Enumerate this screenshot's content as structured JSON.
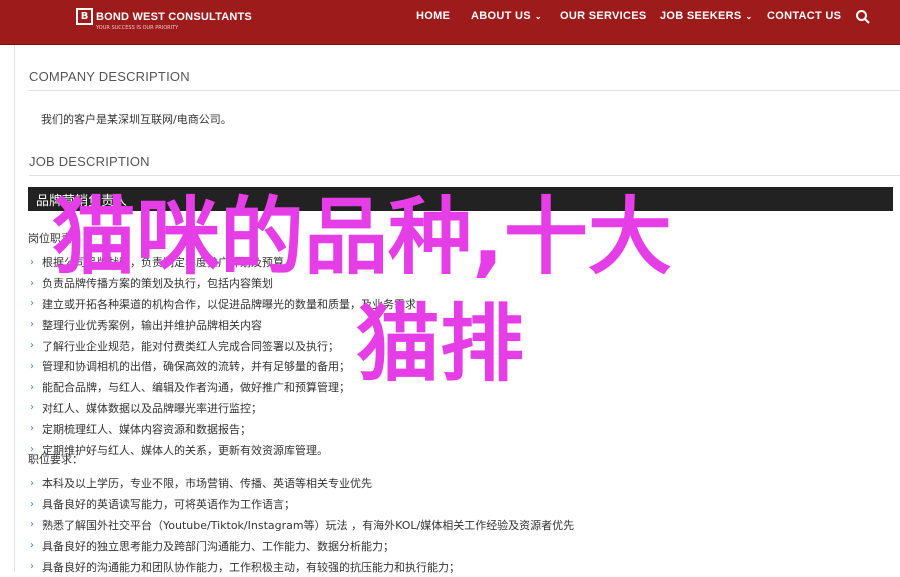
{
  "brand": {
    "name": "BOND WEST CONSULTANTS",
    "mark": "B",
    "tagline": "YOUR SUCCESS IS OUR PRIORITY"
  },
  "nav": [
    {
      "label": "HOME",
      "caret": false
    },
    {
      "label": "ABOUT US",
      "caret": true
    },
    {
      "label": "OUR SERVICES",
      "caret": false
    },
    {
      "label": "JOB SEEKERS",
      "caret": true
    },
    {
      "label": "CONTACT US",
      "caret": false
    }
  ],
  "company": {
    "heading": "COMPANY DESCRIPTION",
    "text": "我们的客户是某深圳互联网/电商公司。"
  },
  "job": {
    "heading": "JOB DESCRIPTION",
    "title": "品牌营销负责人",
    "duties_label": "岗位职责：",
    "duties": [
      "根据公司品牌战略，负责制定年度推广计划及预算",
      "负责品牌传播方案的策划及执行，包括内容策划",
      "建立或开拓各种渠道的机构合作，以促进品牌曝光的数量和质量，及业务需求；",
      "整理行业优秀案例，输出并维护品牌相关内容",
      "了解行业企业规范，能对付费类红人完成合同签署以及执行；",
      "管理和协调相机的出借，确保高效的流转，并有足够量的备用；",
      "能配合品牌，与红人、编辑及作者沟通，做好推广和预算管理；",
      "对红人、媒体数据以及品牌曝光率进行监控；",
      "定期梳理红人、媒体内容资源和数据报告；",
      "定期维护好与红人、媒体人的关系，更新有效资源库管理。"
    ],
    "req_label": "职位要求：",
    "requirements": [
      "本科及以上学历，专业不限，市场营销、传播、英语等相关专业优先",
      "具备良好的英语读写能力，可将英语作为工作语言；",
      "熟悉了解国外社交平台（Youtube/Tiktok/Instagram等）玩法 ，有海外KOL/媒体相关工作经验及资源者优先",
      "具备良好的独立思考能力及跨部门沟通能力、工作能力、数据分析能力；",
      "具备良好的沟通能力和团队协作能力，工作积极主动，有较强的抗压能力和执行能力；"
    ]
  },
  "overlay": {
    "line1": "猫咪的品种,十大",
    "line2": "猫排"
  },
  "colors": {
    "topbar": "#9e1b1b",
    "overlay": "#e63ee6",
    "bullet": "#3b7ec6"
  }
}
